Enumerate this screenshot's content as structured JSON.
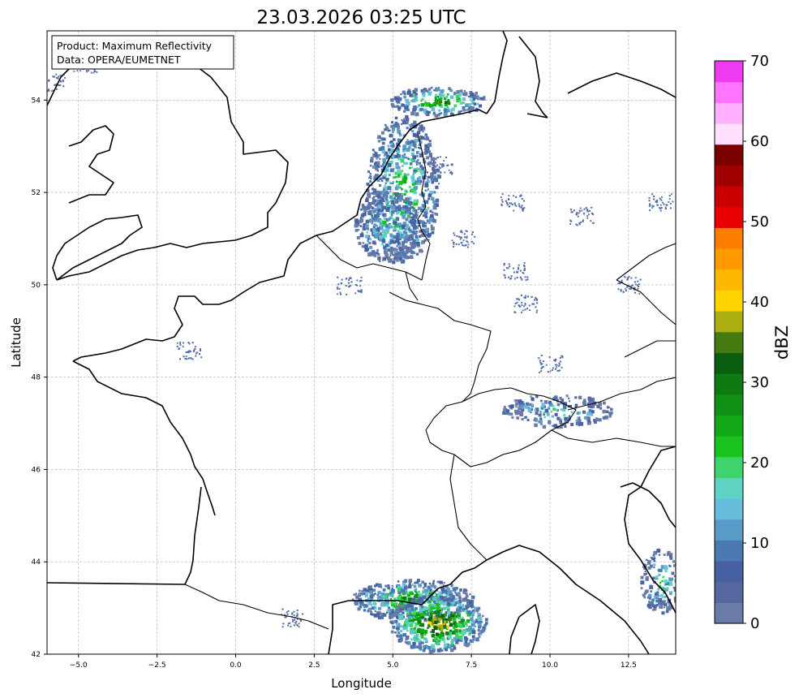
{
  "title": "23.03.2026 03:25 UTC",
  "info_box": {
    "product": "Product: Maximum Reflectivity",
    "source": "Data: OPERA/EUMETNET"
  },
  "axes": {
    "xlabel": "Longitude",
    "ylabel": "Latitude",
    "xlim": [
      -6,
      14
    ],
    "ylim": [
      42,
      55.5
    ],
    "xticks": [
      "−5.0",
      "−2.5",
      "0.0",
      "2.5",
      "5.0",
      "7.5",
      "10.0",
      "12.5"
    ],
    "yticks": [
      "42",
      "44",
      "46",
      "48",
      "50",
      "52",
      "54"
    ]
  },
  "colorbar": {
    "label": "dBZ",
    "min": 0,
    "max": 70,
    "ticks": [
      "0",
      "10",
      "20",
      "30",
      "40",
      "50",
      "60",
      "70"
    ],
    "colors": [
      "#6a7ba8",
      "#55679e",
      "#4560a3",
      "#4a78b0",
      "#5a9cc8",
      "#66bedc",
      "#5fd4c4",
      "#3ed46d",
      "#18c41c",
      "#12a818",
      "#109014",
      "#0e7a12",
      "#0a5e10",
      "#457a10",
      "#aaae10",
      "#ffd500",
      "#ffb800",
      "#ff9a00",
      "#ff7e00",
      "#e80000",
      "#c80000",
      "#a00000",
      "#7a0000",
      "#ffe0ff",
      "#ffb0ff",
      "#ff75ff",
      "#f03cf0"
    ]
  },
  "legend_colors": {
    "coastline": "#000000",
    "grid": "#b0b0b0"
  },
  "precip_cells": [
    {
      "lon": 5.3,
      "lat": 52.1,
      "intensity": 22
    },
    {
      "lon": 4.8,
      "lat": 51.3,
      "intensity": 18
    },
    {
      "lon": 6.4,
      "lat": 54.0,
      "intensity": 30
    },
    {
      "lon": 5.6,
      "lat": 43.2,
      "intensity": 28
    },
    {
      "lon": 6.4,
      "lat": 42.7,
      "intensity": 40
    },
    {
      "lon": 10.2,
      "lat": 47.3,
      "intensity": 15
    },
    {
      "lon": 13.5,
      "lat": 43.6,
      "intensity": 18
    }
  ]
}
